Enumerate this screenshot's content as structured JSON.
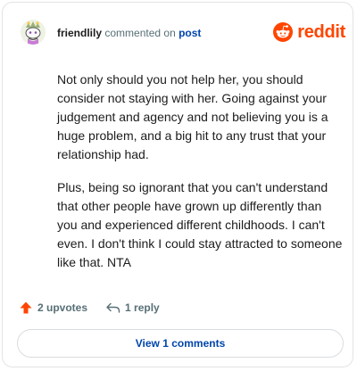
{
  "comment": {
    "username": "friendlily",
    "action_text": "commented on",
    "post_link_label": "post",
    "avatar_icon": "snoo-avatar-icon",
    "paragraphs": [
      "Not only should you not help her, you should consider not staying with her. Going against your judgement and agency and not believing you is a huge problem, and a big hit to any trust that your relationship had.",
      "Plus, being so ignorant that you can't understand that other people have grown up differently than you and experienced different childhoods. I can't even. I don't think I could stay attracted to someone like that. NTA"
    ]
  },
  "brand": {
    "name": "reddit",
    "icon": "reddit-logo-icon",
    "color": "#ff4500"
  },
  "footer": {
    "upvotes_label": "2 upvotes",
    "upvote_icon": "upvote-arrow-icon",
    "replies_label": "1 reply",
    "reply_icon": "reply-icon"
  },
  "view_comments_label": "View 1 comments",
  "colors": {
    "accent": "#ff4500",
    "link": "#0045ac",
    "muted": "#576f76",
    "border": "#e3e3e3"
  }
}
